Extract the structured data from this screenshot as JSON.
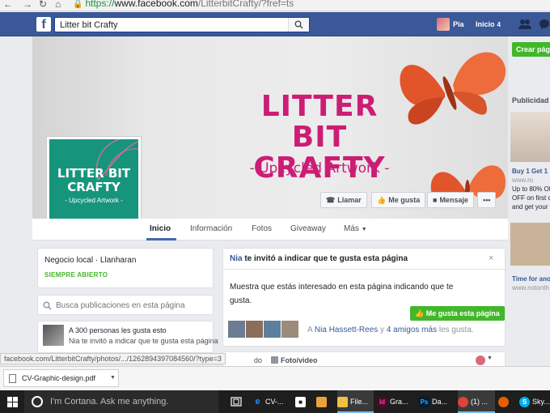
{
  "browser": {
    "url_scheme": "https://",
    "url_domain": "www.facebook.com",
    "url_path": "/LitterbitCrafty/?fref=ts"
  },
  "fb_header": {
    "logo": "f",
    "search_value": "Litter bit Crafty",
    "user_name": "Pia",
    "home_label": "Inicio",
    "home_count": "4"
  },
  "cover": {
    "title_line1": "LITTER BIT",
    "title_line2": "CRAFTY",
    "subtitle": "- Upcycled Artwork -",
    "profile_title_line1": "LITTER BIT",
    "profile_title_line2": "CRAFTY",
    "profile_subtitle": "- Upcycled Artwork -",
    "buttons": {
      "call": "Llamar",
      "like": "Me gusta",
      "message": "Mensaje",
      "more": "•••"
    }
  },
  "tabs": [
    {
      "label": "Inicio"
    },
    {
      "label": "Información"
    },
    {
      "label": "Fotos"
    },
    {
      "label": "Giveaway"
    },
    {
      "label": "Más"
    }
  ],
  "about": {
    "category": "Negocio local · Llanharan",
    "hours": "SIEMPRE ABIERTO"
  },
  "search_posts": {
    "placeholder": "Busca publicaciones en esta página"
  },
  "likes": {
    "headline": "A 300 personas les gusta esto",
    "invite_note": "Nia te invitó a indicar que te gusta esta página"
  },
  "invite": {
    "inviter": "Nia",
    "header_rest": "te invitó a indicar que te gusta esta página",
    "close": "×",
    "body": "Muestra que estás interesado en esta página indicando que te gusta.",
    "like_button": "Me gusta esta página",
    "friends_prefix": "A",
    "friend_name": "Nia Hassett-Rees",
    "friends_mid": "y",
    "friends_more": "4 amigos más",
    "friends_suffix": "les gusta."
  },
  "composer": {
    "partial_label": "do",
    "photo_video": "Foto/video"
  },
  "sidebar": {
    "create_page": "Crear pág",
    "ads_label": "Publicidad",
    "ad1_title": "Buy 1 Get 1",
    "ad1_domain": "www.ro",
    "ad1_line1": "Up to 80% Of",
    "ad1_line2": "OFF on first c",
    "ad1_line3": "and get your",
    "ad2_title": "Time for ano",
    "ad2_domain": "www.notonth"
  },
  "status_bar": {
    "url": "facebook.com/LitterbitCrafty/photos/.../1262894397084560/?type=3"
  },
  "downloads": {
    "file": "CV-Graphic-design.pdf"
  },
  "taskbar": {
    "cortana": "I'm Cortana. Ask me anything.",
    "items": [
      {
        "label": "CV-..."
      },
      {
        "label": "File..."
      },
      {
        "label": "Gra..."
      },
      {
        "label": "Da..."
      },
      {
        "label": "(1) ..."
      },
      {
        "label": "Sky..."
      }
    ]
  },
  "colors": {
    "fb_blue": "#3b5998",
    "brand_pink": "#cc1d75",
    "teal": "#17957c",
    "green": "#42b72a"
  }
}
